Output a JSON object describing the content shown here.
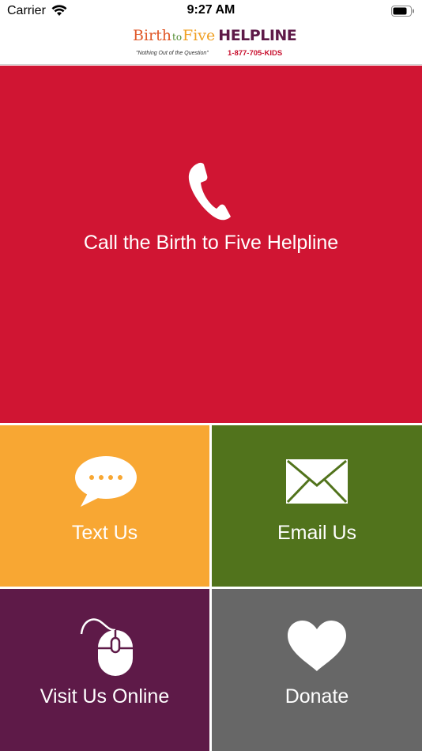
{
  "status": {
    "carrier": "Carrier",
    "time": "9:27 AM"
  },
  "logo": {
    "birth": "Birth",
    "to": "to",
    "five": "Five",
    "helpline": "HELPLINE",
    "tagline": "\"Nothing Out of the Question\"",
    "phone": "1-877-705-KIDS"
  },
  "tiles": {
    "call": {
      "label": "Call the Birth to Five Helpline",
      "icon": "phone-icon",
      "color": "#d01533"
    },
    "text": {
      "label": "Text Us",
      "icon": "chat-bubble-icon",
      "color": "#f8a733"
    },
    "email": {
      "label": "Email Us",
      "icon": "envelope-icon",
      "color": "#51731c"
    },
    "visit": {
      "label": "Visit Us Online",
      "icon": "mouse-icon",
      "color": "#5e1a48"
    },
    "donate": {
      "label": "Donate",
      "icon": "heart-icon",
      "color": "#676767"
    }
  }
}
